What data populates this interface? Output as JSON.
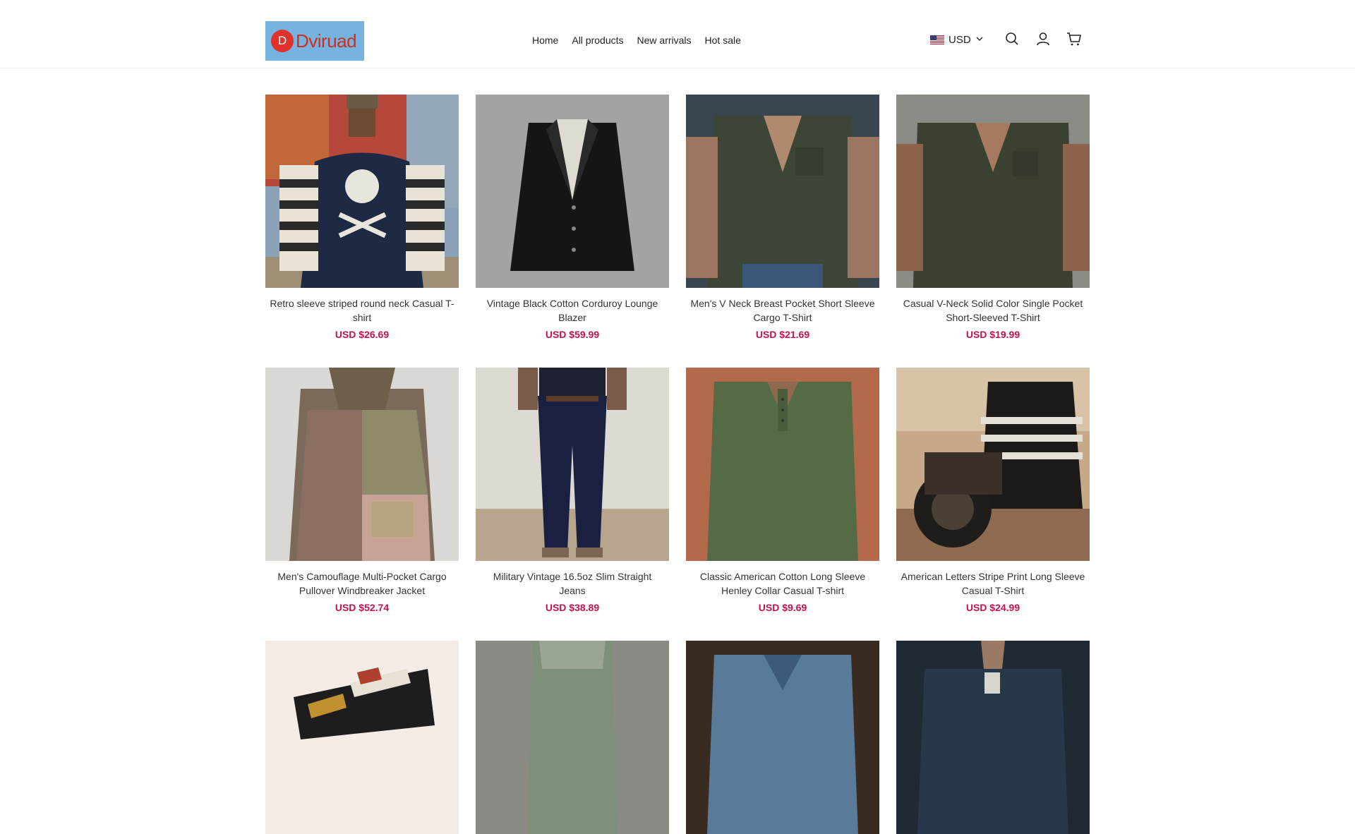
{
  "header": {
    "logo_letter": "D",
    "logo_text": "Dviruad",
    "nav": [
      "Home",
      "All products",
      "New arrivals",
      "Hot sale"
    ],
    "currency": "USD",
    "icons": [
      "chevron-down-icon",
      "search-icon",
      "user-icon",
      "cart-icon"
    ]
  },
  "colors": {
    "price": "#c21153",
    "logo_bg": "#74b4de",
    "logo_text": "#d52a20"
  },
  "products": [
    {
      "title": "Retro sleeve striped round neck Casual T-shirt",
      "price": "USD $26.69"
    },
    {
      "title": "Vintage Black Cotton Corduroy Lounge Blazer",
      "price": "USD $59.99"
    },
    {
      "title": "Men's V Neck Breast Pocket Short Sleeve Cargo T-Shirt",
      "price": "USD $21.69"
    },
    {
      "title": "Casual V-Neck Solid Color Single Pocket Short-Sleeved T-Shirt",
      "price": "USD $19.99"
    },
    {
      "title": "Men's Camouflage Multi-Pocket Cargo Pullover Windbreaker Jacket",
      "price": "USD $52.74"
    },
    {
      "title": "Military Vintage 16.5oz Slim Straight Jeans",
      "price": "USD $38.89"
    },
    {
      "title": "Classic American Cotton Long Sleeve Henley Collar Casual T-shirt",
      "price": "USD $9.69"
    },
    {
      "title": "American Letters Stripe Print Long Sleeve Casual T-Shirt",
      "price": "USD $24.99"
    }
  ]
}
